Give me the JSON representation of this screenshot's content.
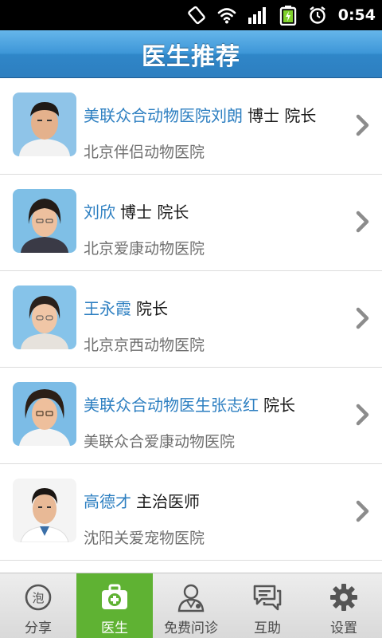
{
  "status_bar": {
    "time": "0:54",
    "icons": [
      "screen-rotate-icon",
      "wifi-icon",
      "signal-icon",
      "battery-charging-icon",
      "alarm-icon"
    ]
  },
  "header": {
    "title": "医生推荐"
  },
  "doctors": [
    {
      "name": "美联众合动物医院刘朗",
      "title": "博士 院长",
      "hospital": "北京伴侣动物医院"
    },
    {
      "name": "刘欣",
      "title": "博士 院长",
      "hospital": "北京爱康动物医院"
    },
    {
      "name": "王永霞",
      "title": "院长",
      "hospital": "北京京西动物医院"
    },
    {
      "name": "美联众合动物医生张志红",
      "title": "院长",
      "hospital": "美联众合爱康动物医院"
    },
    {
      "name": "高德才",
      "title": "主治医师",
      "hospital": "沈阳关爱宠物医院"
    }
  ],
  "tabs": [
    {
      "label": "分享",
      "icon": "bubble-icon",
      "active": false
    },
    {
      "label": "医生",
      "icon": "medical-kit-icon",
      "active": true
    },
    {
      "label": "免费问诊",
      "icon": "doctor-consult-icon",
      "active": false
    },
    {
      "label": "互助",
      "icon": "chat-icon",
      "active": false
    },
    {
      "label": "设置",
      "icon": "gear-icon",
      "active": false
    }
  ],
  "colors": {
    "accent_blue": "#2d7fc1",
    "title_bar": "#3e97d8",
    "tab_active": "#5fb233",
    "hospital_text": "#6f6f6f"
  }
}
